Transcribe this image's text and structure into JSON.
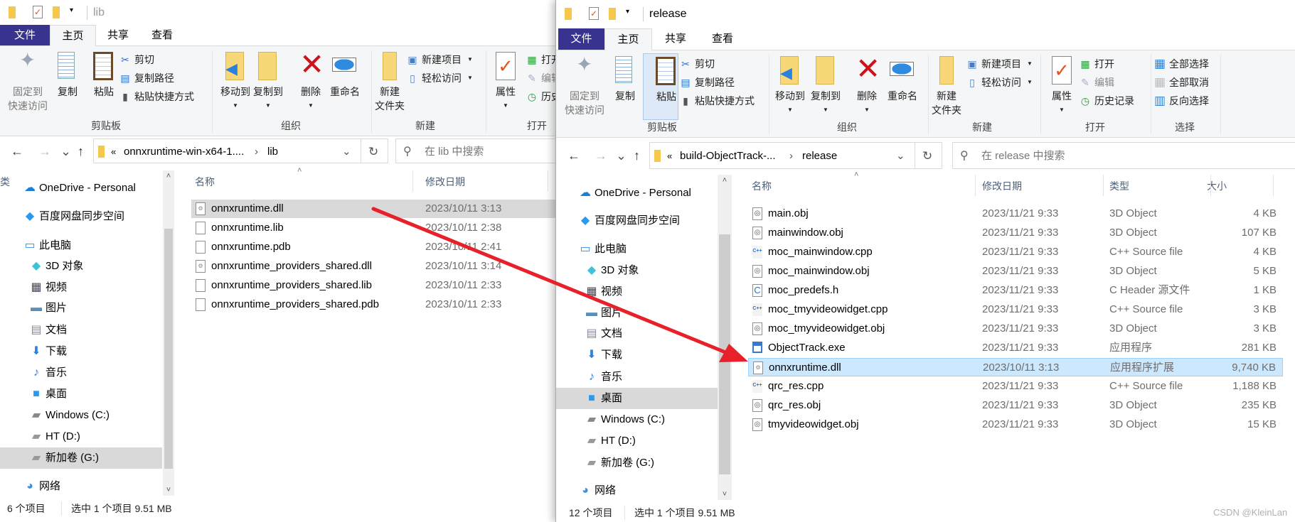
{
  "left": {
    "title": "lib",
    "tabs": [
      "文件",
      "主页",
      "共享",
      "查看"
    ],
    "ribbon": {
      "pin": [
        "固定到",
        "快速访问"
      ],
      "copy": "复制",
      "paste": "粘贴",
      "cut": "剪切",
      "copy_path": "复制路径",
      "paste_shortcut": "粘贴快捷方式",
      "move_to": "移动到",
      "copy_to": "复制到",
      "delete": "删除",
      "rename": "重命名",
      "new_folder": [
        "新建",
        "文件夹"
      ],
      "new_item": "新建项目",
      "easy_access": "轻松访问",
      "properties": "属性",
      "open": "打开",
      "edit": "编辑",
      "history": "历史记录",
      "groups": [
        "剪贴板",
        "组织",
        "新建",
        "打开"
      ]
    },
    "address": {
      "prefix": "«",
      "parent": "onnxruntime-win-x64-1....",
      "current": "lib",
      "search_placeholder": "在 lib 中搜索"
    },
    "columns": [
      "名称",
      "修改日期",
      "类"
    ],
    "nav": [
      "OneDrive - Personal",
      "百度网盘同步空间",
      "此电脑",
      "3D 对象",
      "视频",
      "图片",
      "文档",
      "下载",
      "音乐",
      "桌面",
      "Windows (C:)",
      "HT (D:)",
      "新加卷 (G:)",
      "网络"
    ],
    "nav_selected": "新加卷 (G:)",
    "files": [
      {
        "name": "onnxruntime.dll",
        "date": "2023/10/11 3:13",
        "icon": "dll",
        "selected": true
      },
      {
        "name": "onnxruntime.lib",
        "date": "2023/10/11 2:38",
        "icon": "file"
      },
      {
        "name": "onnxruntime.pdb",
        "date": "2023/10/11 2:41",
        "icon": "file"
      },
      {
        "name": "onnxruntime_providers_shared.dll",
        "date": "2023/10/11 3:14",
        "icon": "dll"
      },
      {
        "name": "onnxruntime_providers_shared.lib",
        "date": "2023/10/11 2:33",
        "icon": "file"
      },
      {
        "name": "onnxruntime_providers_shared.pdb",
        "date": "2023/10/11 2:33",
        "icon": "file"
      }
    ],
    "status": {
      "count": "6 个项目",
      "selection": "选中 1 个项目  9.51 MB"
    }
  },
  "right": {
    "title": "release",
    "tabs": [
      "文件",
      "主页",
      "共享",
      "查看"
    ],
    "ribbon": {
      "pin": [
        "固定到",
        "快速访问"
      ],
      "copy": "复制",
      "paste": "粘贴",
      "cut": "剪切",
      "copy_path": "复制路径",
      "paste_shortcut": "粘贴快捷方式",
      "move_to": "移动到",
      "copy_to": "复制到",
      "delete": "删除",
      "rename": "重命名",
      "new_folder": [
        "新建",
        "文件夹"
      ],
      "new_item": "新建项目",
      "easy_access": "轻松访问",
      "properties": "属性",
      "open": "打开",
      "edit": "编辑",
      "history": "历史记录",
      "select_all": "全部选择",
      "select_none": "全部取消",
      "invert": "反向选择",
      "groups": [
        "剪贴板",
        "组织",
        "新建",
        "打开",
        "选择"
      ]
    },
    "address": {
      "prefix": "«",
      "parent": "build-ObjectTrack-...",
      "current": "release",
      "search_placeholder": "在 release 中搜索"
    },
    "columns": [
      "名称",
      "修改日期",
      "类型",
      "大小"
    ],
    "nav": [
      "OneDrive - Personal",
      "百度网盘同步空间",
      "此电脑",
      "3D 对象",
      "视频",
      "图片",
      "文档",
      "下载",
      "音乐",
      "桌面",
      "Windows (C:)",
      "HT (D:)",
      "新加卷 (G:)",
      "网络"
    ],
    "nav_selected": "桌面",
    "files": [
      {
        "name": "main.obj",
        "date": "2023/11/21 9:33",
        "type": "3D Object",
        "size": "4 KB",
        "icon": "obj"
      },
      {
        "name": "mainwindow.obj",
        "date": "2023/11/21 9:33",
        "type": "3D Object",
        "size": "107 KB",
        "icon": "obj"
      },
      {
        "name": "moc_mainwindow.cpp",
        "date": "2023/11/21 9:33",
        "type": "C++ Source file",
        "size": "4 KB",
        "icon": "cpp"
      },
      {
        "name": "moc_mainwindow.obj",
        "date": "2023/11/21 9:33",
        "type": "3D Object",
        "size": "5 KB",
        "icon": "obj"
      },
      {
        "name": "moc_predefs.h",
        "date": "2023/11/21 9:33",
        "type": "C Header 源文件",
        "size": "1 KB",
        "icon": "h"
      },
      {
        "name": "moc_tmyvideowidget.cpp",
        "date": "2023/11/21 9:33",
        "type": "C++ Source file",
        "size": "3 KB",
        "icon": "cpp"
      },
      {
        "name": "moc_tmyvideowidget.obj",
        "date": "2023/11/21 9:33",
        "type": "3D Object",
        "size": "3 KB",
        "icon": "obj"
      },
      {
        "name": "ObjectTrack.exe",
        "date": "2023/11/21 9:33",
        "type": "应用程序",
        "size": "281 KB",
        "icon": "exe"
      },
      {
        "name": "onnxruntime.dll",
        "date": "2023/10/11 3:13",
        "type": "应用程序扩展",
        "size": "9,740 KB",
        "icon": "dll",
        "selected": true
      },
      {
        "name": "qrc_res.cpp",
        "date": "2023/11/21 9:33",
        "type": "C++ Source file",
        "size": "1,188 KB",
        "icon": "cpp"
      },
      {
        "name": "qrc_res.obj",
        "date": "2023/11/21 9:33",
        "type": "3D Object",
        "size": "235 KB",
        "icon": "obj"
      },
      {
        "name": "tmyvideowidget.obj",
        "date": "2023/11/21 9:33",
        "type": "3D Object",
        "size": "15 KB",
        "icon": "obj"
      }
    ],
    "status": {
      "count": "12 个项目",
      "selection": "选中 1 个项目  9.51 MB"
    }
  },
  "annotation": {
    "arrow_color": "#e8202a",
    "from": "left onnxruntime.dll",
    "to": "right onnxruntime.dll"
  },
  "watermark": "CSDN @KleinLan",
  "colors": {
    "file_tab": "#37338f",
    "selection_blue": "#cce8ff",
    "selection_gray": "#d9d9d9"
  }
}
